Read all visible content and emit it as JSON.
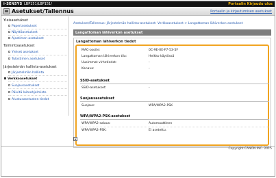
{
  "topbar": {
    "brand": "i-SENSYS",
    "model": "LBP151/LBP151/",
    "links": "Portaalin  Kirjaudu ulos"
  },
  "header": {
    "title": "Asetukset/Tallennus",
    "link": "Portaalin ja kirjautumisen asetukset"
  },
  "sidebar": {
    "items": [
      {
        "type": "cat",
        "label": "Yleisasetukset"
      },
      {
        "type": "item",
        "label": "Paperiasetukset"
      },
      {
        "type": "item",
        "label": "Näyttöasetukset"
      },
      {
        "type": "item",
        "label": "Ajastimen asetukset"
      },
      {
        "type": "cat",
        "label": "Toimintoasetukset"
      },
      {
        "type": "item",
        "label": "Yleiset asetukset"
      },
      {
        "type": "item",
        "label": "Tulostimen asetukset"
      },
      {
        "type": "cat",
        "label": "Järjestelmän hallinta-asetukset"
      },
      {
        "type": "item",
        "label": "Järjestelmän hallinta"
      },
      {
        "type": "item",
        "label": "Verkkoasetukset",
        "active": true
      },
      {
        "type": "item",
        "label": "Suojausasetukset"
      },
      {
        "type": "item",
        "label": "Päivitä laiteohjelmisto"
      },
      {
        "type": "item",
        "label": "Alustusasetusten tiedot"
      }
    ]
  },
  "main": {
    "breadcrumb": "Asetukset/Tallennus: Järjestelmän hallinta-asetukset: Verkkoasetukset > Langattoman lähiverkon asetukset",
    "toolbar_title": "Langattoman lähiverkon asetukset",
    "panel_title": "Langattoman lähiverkon tiedot",
    "info_rows": [
      {
        "label": "MAC-osoite:",
        "value": "0C-9E-0E-F7-53-5F"
      },
      {
        "label": "Langattoman lähiverkon tila:",
        "value": "Heikko käytössä"
      },
      {
        "label": "Uusimmat virhetiedot:",
        "value": "-"
      },
      {
        "label": "Kanava:",
        "value": "-"
      }
    ],
    "ssid": {
      "header": "SSID-asetukset",
      "rows": [
        {
          "label": "SSID-asetukset:",
          "value": "-"
        }
      ]
    },
    "security": {
      "header": "Suojausasetukset",
      "rows": [
        {
          "label": "Suojaus:",
          "value": "WPA/WPA2-PSK"
        }
      ]
    },
    "wpa": {
      "header": "WPA/WPA2-PSK-asetukset",
      "rows": [
        {
          "label": "WPA/WPA2-salaus:",
          "value": "Automaattinen"
        },
        {
          "label": "WPA/WPA2-PSK:",
          "value": "Ei asetettu."
        }
      ]
    }
  },
  "footer": {
    "copyright": "Copyright CANON INC. 2015"
  },
  "colors": {
    "highlight": "#f1a420",
    "link": "#2a5db0",
    "toolbar": "#7d7d7d"
  }
}
